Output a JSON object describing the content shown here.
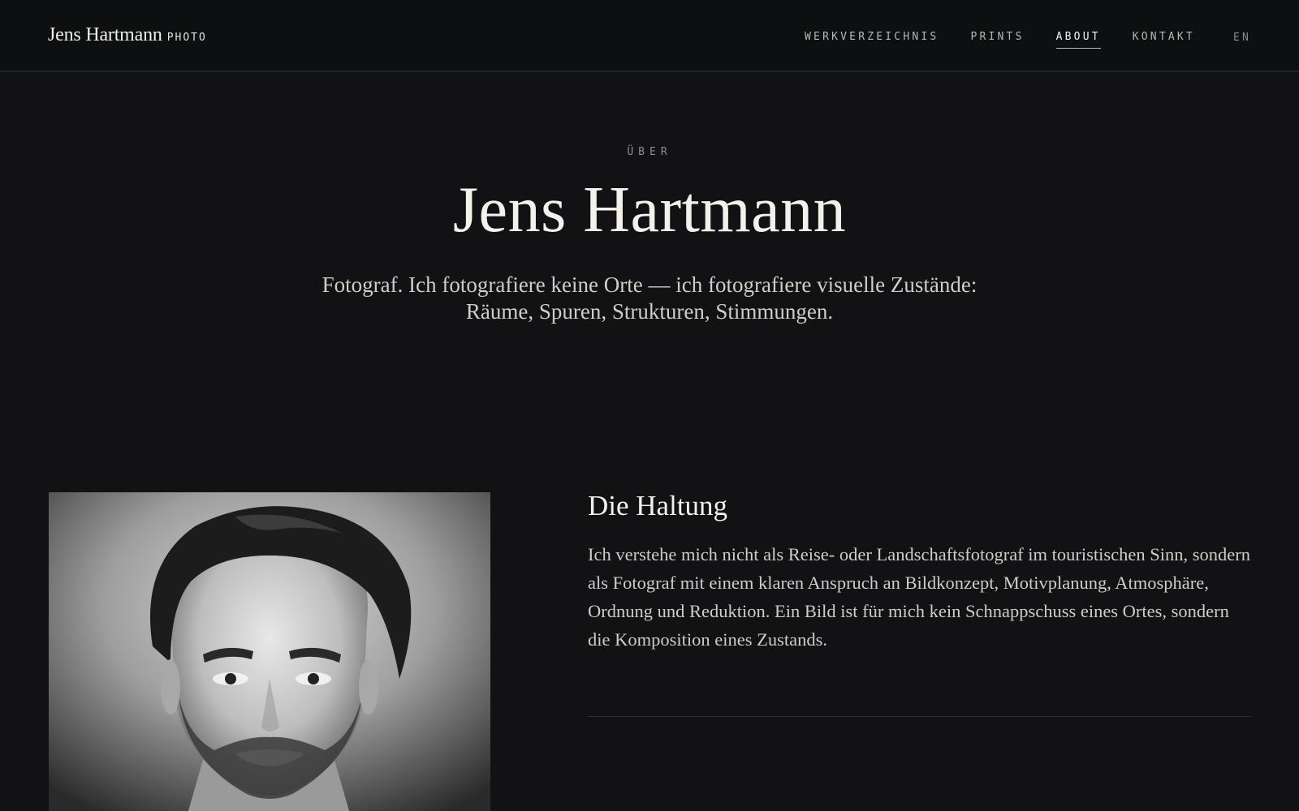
{
  "header": {
    "brand_name": "Jens Hartmann",
    "brand_tag": "PHOTO",
    "nav": [
      {
        "label": "WERKVERZEICHNIS",
        "active": false
      },
      {
        "label": "PRINTS",
        "active": false
      },
      {
        "label": "ABOUT",
        "active": true
      },
      {
        "label": "KONTAKT",
        "active": false
      }
    ],
    "language": "EN"
  },
  "hero": {
    "eyebrow": "ÜBER",
    "title": "Jens Hartmann",
    "subtitle": "Fotograf. Ich fotografiere keine Orte — ich fotografiere visuelle Zustände: Räume, Spuren, Strukturen, Stimmungen."
  },
  "section": {
    "heading": "Die Haltung",
    "body": "Ich verstehe mich nicht als Reise- oder Landschaftsfotograf im touristischen Sinn, sondern als Fotograf mit einem klaren Anspruch an Bildkonzept, Motivplanung, Atmosphäre, Ordnung und Reduktion. Ein Bild ist für mich kein Schnappschuss eines Ortes, sondern die Komposition eines Zustands."
  },
  "colors": {
    "background": "#121214",
    "header_background": "#0e0f11",
    "text_primary": "#f3f1ec",
    "text_muted": "#8f8d89"
  }
}
